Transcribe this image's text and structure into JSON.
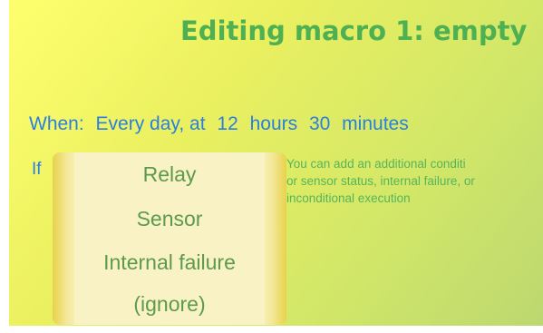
{
  "page": {
    "title": "Editing macro 1: empty"
  },
  "schedule": {
    "when_label": "When:",
    "frequency": "Every day, at",
    "hours_value": "12",
    "hours_label": "hours",
    "minutes_value": "30",
    "minutes_label": "minutes"
  },
  "condition": {
    "if_label": "If",
    "options": [
      "Relay",
      "Sensor",
      "Internal failure",
      "(ignore)"
    ],
    "help_lines": [
      "You can add an additional conditi",
      "or sensor status, internal failure, or",
      "inconditional execution"
    ]
  },
  "colors": {
    "title": "#4eb052",
    "accent_blue": "#2a7fe0",
    "option_text": "#5d9a4e",
    "help_text": "#56b45c",
    "background_start": "#ffff6e",
    "background_end": "#bcd870"
  }
}
